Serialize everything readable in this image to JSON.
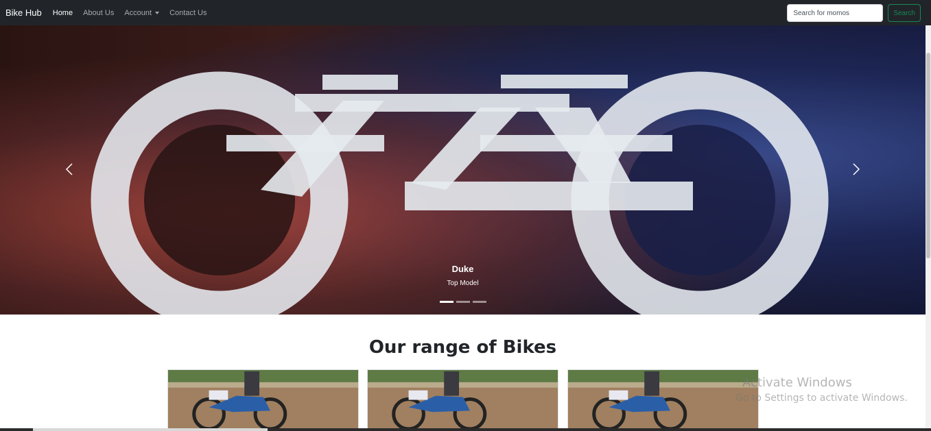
{
  "navbar": {
    "brand": "Bike Hub",
    "links": [
      {
        "label": "Home",
        "active": true
      },
      {
        "label": "About Us",
        "active": false
      },
      {
        "label": "Account",
        "active": false,
        "dropdown": true
      },
      {
        "label": "Contact Us",
        "active": false
      }
    ],
    "search": {
      "placeholder": "Search for momos",
      "value": "",
      "button_label": "Search"
    }
  },
  "carousel": {
    "caption_title": "Duke",
    "caption_text": "Top Model",
    "slide_count": 3,
    "active_slide": 1,
    "prev_icon": "chevron-left-icon",
    "next_icon": "chevron-right-icon"
  },
  "section": {
    "title": "Our range of Bikes",
    "cards": [
      {
        "image": "dirt-bike-photo"
      },
      {
        "image": "dirt-bike-photo"
      },
      {
        "image": "dirt-bike-photo"
      }
    ]
  },
  "watermark": {
    "line1": "Activate Windows",
    "line2": "Go to Settings to activate Windows."
  },
  "colors": {
    "navbar_bg": "#212529",
    "search_button": "#198754"
  }
}
